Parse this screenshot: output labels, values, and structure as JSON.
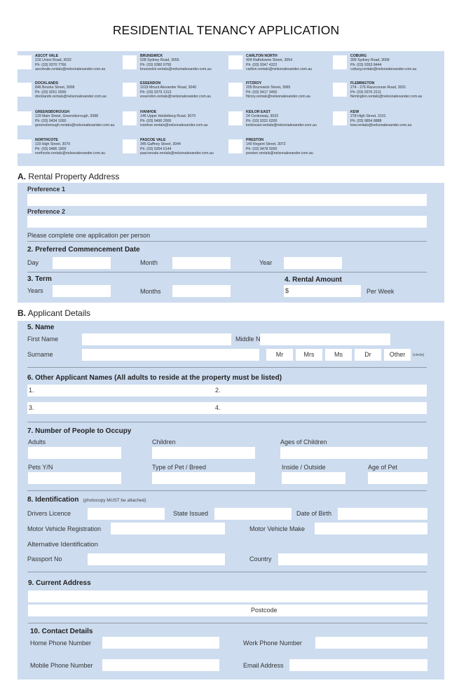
{
  "title": "RESIDENTIAL TENANCY APPLICATION",
  "offices": [
    {
      "name": "ASCOT VALE",
      "address": "216 Union Road, 3032",
      "phone": "Ph: (03) 9370 7766",
      "email": "ascotvale.rentals@nelsonalexander.com.au"
    },
    {
      "name": "BRUNSWICK",
      "address": "528 Sydney Road, 3056",
      "phone": "Ph: (03) 9380 9755",
      "email": "brunswick.rentals@nelsonalexander.com.au"
    },
    {
      "name": "CARLTON NORTH",
      "address": "404 Rathdowne Street, 3054",
      "phone": "Ph: (03) 9347 4322",
      "email": "carlton.rentals@nelsonalexander.com.au"
    },
    {
      "name": "COBURG",
      "address": "399 Sydney Road, 3058",
      "phone": "Ph: (03) 9353 8444",
      "email": "coburg.rentals@nelsonalexander.com.au"
    },
    {
      "name": "DOCKLANDS",
      "address": "846 Bourke Street, 3008",
      "phone": "Ph: (03) 9251 9000",
      "email": "docklands.rentals@nelsonalexander.com.au"
    },
    {
      "name": "ESSENDON",
      "address": "1019 Mount Alexander Road, 3040",
      "phone": "Ph: (03) 9379 1313",
      "email": "essendon.rentals@nelsonalexander.com.au"
    },
    {
      "name": "FITZROY",
      "address": "205 Brunswick Street, 3065",
      "phone": "Ph: (03) 9417 3455",
      "email": "fitzroy.rentals@nelsonalexander.com.au"
    },
    {
      "name": "FLEMINGTON",
      "address": "274 - 276 Racecourse Road, 3031",
      "phone": "Ph: (03) 9376 2211",
      "email": "flemington.rentals@nelsonalexander.com.au"
    },
    {
      "name": "GREENSBOROUGH",
      "address": "129 Main Street, Greensborough, 3088",
      "phone": "Ph: (03) 9434 1000",
      "email": "greensborough.rentals@nelsonalexander.com.au"
    },
    {
      "name": "IVANHOE",
      "address": "146 Upper Heidelberg Road, 3079",
      "phone": "Ph: (03) 9490 2900",
      "email": "ivanhoe.rentals@nelsonalexander.com.au"
    },
    {
      "name": "KEILOR EAST",
      "address": "24 Centreway, 3033",
      "phone": "Ph: (03) 9331 6200",
      "email": "keiloreast.rentals@nelsonalexander.com.au"
    },
    {
      "name": "KEW",
      "address": "278 High Street, 3101",
      "phone": "Ph: (03) 9854 8888",
      "email": "kew.rentals@nelsonalexander.com.au"
    },
    {
      "name": "NORTHCOTE",
      "address": "119 High Street, 3070",
      "phone": "Ph: (03) 9486 1800",
      "email": "northcote.rentals@nelsonalexander.com.au"
    },
    {
      "name": "PASCOE VALE",
      "address": "345 Gaffney Street, 3044",
      "phone": "Ph: (03) 9354 6144",
      "email": "pascoevale.rentals@nelsonalexander.com.au"
    },
    {
      "name": "PRESTON",
      "address": "140 Regent Street, 3072",
      "phone": "Ph: (03) 9478 5000",
      "email": "preston.rentals@nelsonalexander.com.au"
    }
  ],
  "sectionA": {
    "letter": "A.",
    "title": " Rental Property Address",
    "pref1": "Preference 1",
    "pref2": "Preference 2",
    "note": "Please complete one application per person",
    "commencement": {
      "heading": "2. Preferred Commencement Date",
      "day": "Day",
      "month": "Month",
      "year": "Year"
    },
    "term": {
      "heading": "3. Term",
      "years": "Years",
      "months": "Months"
    },
    "rental": {
      "heading": "4. Rental Amount",
      "prefix": "$",
      "suffix": "Per Week"
    }
  },
  "sectionB": {
    "letter": "B.",
    "title": " Applicant Details",
    "name": {
      "heading": "5. Name",
      "first": "First Name",
      "middle": "Middle Name",
      "surname": "Surname",
      "titles": [
        "Mr",
        "Mrs",
        "Ms",
        "Dr",
        "Other"
      ],
      "circle_note": "(circle)"
    },
    "others": {
      "heading": "6. Other Applicant Names (All adults to reside at the property must be listed)",
      "n1": "1.",
      "n2": "2.",
      "n3": "3.",
      "n4": "4."
    },
    "occupy": {
      "heading": "7. Number of People to Occupy",
      "adults": "Adults",
      "children": "Children",
      "ages": "Ages of Children",
      "pets": "Pets Y/N",
      "pet_type": "Type of Pet / Breed",
      "inside": "Inside / Outside",
      "pet_age": "Age of Pet"
    },
    "ident": {
      "heading": "8. Identification",
      "note": "(photocopy MUST be attached)",
      "licence": "Drivers Licence",
      "state": "State Issued",
      "dob": "Date of Birth",
      "rego": "Motor Vehicle Registration",
      "make": "Motor Vehicle Make",
      "alt": "Alternative Identification",
      "passport": "Passport No",
      "country": "Country"
    },
    "address": {
      "heading": "9. Current Address",
      "postcode": "Postcode"
    },
    "contact": {
      "heading": "10. Contact Details",
      "home": "Home Phone Number",
      "work": "Work Phone Number",
      "mobile": "Mobile Phone Number",
      "email": "Email Address"
    }
  }
}
